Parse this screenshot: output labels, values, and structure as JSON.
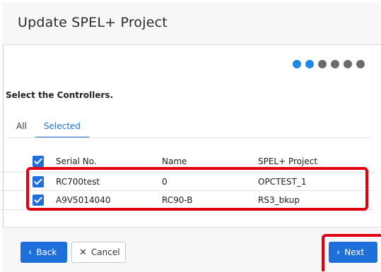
{
  "dialog": {
    "title": "Update SPEL+ Project",
    "steps": {
      "total": 6,
      "current": 2
    },
    "prompt": "Select the Controllers."
  },
  "tabs": [
    {
      "label": "All",
      "selected": false
    },
    {
      "label": "Selected",
      "selected": true
    }
  ],
  "table": {
    "columns": [
      "Serial No.",
      "Name",
      "SPEL+ Project"
    ],
    "rows": [
      {
        "serial": "RC700test",
        "name": "0",
        "project": "OPCTEST_1",
        "checked": true
      },
      {
        "serial": "A9V5014040",
        "name": "RC90-B",
        "project": "RS3_bkup",
        "checked": true
      }
    ],
    "select_all_checked": true
  },
  "footer": {
    "back_label": "Back",
    "cancel_label": "Cancel",
    "next_label": "Next"
  },
  "icons": {
    "back": "chevron-left-icon",
    "cancel": "close-icon",
    "next": "chevron-right-icon"
  },
  "colors": {
    "accent": "#1e6fd9",
    "step_active": "#1e88e5",
    "step_inactive": "#6b6b6b",
    "highlight": "#e00010"
  }
}
